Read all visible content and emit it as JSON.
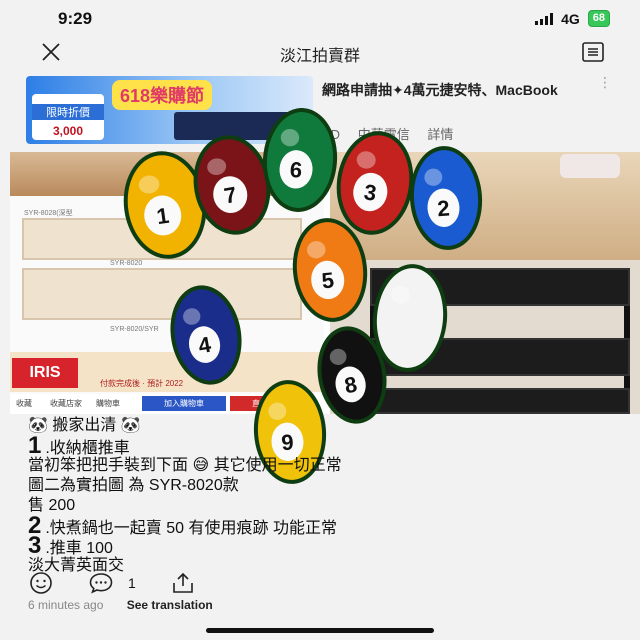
{
  "status_bar": {
    "time": "9:29",
    "network": "4G",
    "battery": "68"
  },
  "nav": {
    "title": "淡江拍賣群",
    "close_icon": "close-icon",
    "menu_icon": "list-icon"
  },
  "ad": {
    "banner": "618樂購節",
    "tag_line1": "限時折價",
    "tag_price": "3,000",
    "title": "網路申請抽✦4萬元捷安特、MacBook",
    "meta_ad": "AD",
    "meta_brand": "中華電信",
    "meta_details": "詳情"
  },
  "photo": {
    "left_labels": [
      "SYR-8028(深型",
      "SYR-8020",
      "SYR-8020/SYR"
    ],
    "brand": "IRIS",
    "promo": "付款完成後 · 預計 2022",
    "shop_labels": [
      "收藏",
      "收藏店家",
      "購物車"
    ],
    "add_to_cart": "加入購物車",
    "buy": "直接"
  },
  "post": {
    "line1": "搬家出清",
    "item1_num": "1",
    "item1": ".收納櫃推車",
    "line3": "當初笨把把手裝到下面 😅 其它使用一切正常",
    "line4": "圖二為實拍圖 為 SYR-8020款",
    "line5": "售 200",
    "item2_num": "2",
    "item2": ".快煮鍋也一起賣 50 有使用痕跡 功能正常",
    "item3_num": "3",
    "item3": ".推車 100",
    "line9": "淡大菁英面交"
  },
  "actions": {
    "comment_count": "1"
  },
  "meta": {
    "time": "6 minutes ago",
    "translate": "See translation"
  },
  "balls": [
    {
      "number": "1",
      "color": "#f2b200"
    },
    {
      "number": "7",
      "color": "#7a1418"
    },
    {
      "number": "6",
      "color": "#0f7a3c"
    },
    {
      "number": "3",
      "color": "#c3221f"
    },
    {
      "number": "2",
      "color": "#1a5bd1"
    },
    {
      "number": "5",
      "color": "#f07b14"
    },
    {
      "number": "4",
      "color": "#1b2d8a"
    },
    {
      "number": "",
      "color": "#f3f3f3"
    },
    {
      "number": "8",
      "color": "#111111"
    },
    {
      "number": "9",
      "color": "#f0c20a"
    }
  ]
}
